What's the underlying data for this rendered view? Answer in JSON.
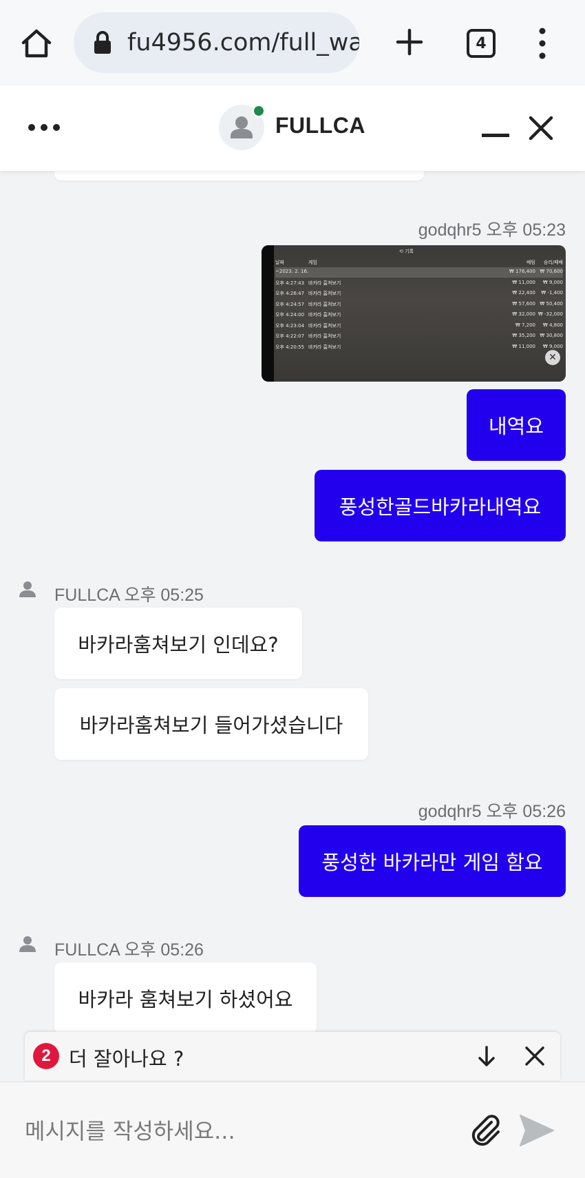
{
  "browser": {
    "url": "fu4956.com/full_wa",
    "tab_count": "4",
    "icons": [
      "home-icon",
      "lock-icon",
      "plus-icon",
      "tabs-icon",
      "kebab-menu-icon"
    ]
  },
  "header": {
    "title": "FULLCA",
    "online": true,
    "online_color": "#1e8a4c"
  },
  "messages": [
    {
      "sender": "godqhr5",
      "time": "오후 05:23",
      "direction": "out",
      "attachment": {
        "type": "image",
        "header": "기록",
        "columns": [
          "날짜",
          "게임",
          "배팅",
          "승리/패배"
        ],
        "rows": [
          {
            "date": "~2023. 2. 16.",
            "game": "",
            "bet": "₩ 176,400",
            "win": "₩ 70,600"
          },
          {
            "date": "오후 4:27:43",
            "game": "바카라 훔쳐보기",
            "bet": "₩ 11,000",
            "win": "₩ 9,000"
          },
          {
            "date": "오후 4:26:47",
            "game": "바카라 훔쳐보기",
            "bet": "₩ 22,400",
            "win": "₩ -1,400"
          },
          {
            "date": "오후 4:24:57",
            "game": "바카라 훔쳐보기",
            "bet": "₩ 57,600",
            "win": "₩ 50,400"
          },
          {
            "date": "오후 4:24:00",
            "game": "바카라 훔쳐보기",
            "bet": "₩ 32,000",
            "win": "₩ -32,000"
          },
          {
            "date": "오후 4:23:04",
            "game": "바카라 훔쳐보기",
            "bet": "₩ 7,200",
            "win": "₩ 4,800"
          },
          {
            "date": "오후 4:22:07",
            "game": "바카라 훔쳐보기",
            "bet": "₩ 35,200",
            "win": "₩ 30,800"
          },
          {
            "date": "오후 4:20:55",
            "game": "바카라 훔쳐보기",
            "bet": "₩ 11,000",
            "win": "₩ 9,000"
          }
        ]
      },
      "texts": [
        "내역요",
        "풍성한골드바카라내역요"
      ]
    },
    {
      "sender": "FULLCA",
      "time": "오후 05:25",
      "direction": "in",
      "texts": [
        "바카라훔쳐보기 인데요?",
        "바카라훔쳐보기 들어가셨습니다"
      ]
    },
    {
      "sender": "godqhr5",
      "time": "오후 05:26",
      "direction": "out",
      "texts": [
        "풍성한 바카라만 게임 함요"
      ]
    },
    {
      "sender": "FULLCA",
      "time": "오후 05:26",
      "direction": "in",
      "texts": [
        "바카라 훔쳐보기 하셨어요"
      ]
    }
  ],
  "notice": {
    "badge": "2",
    "text": "더 잘아나요 ?"
  },
  "composer": {
    "placeholder": "메시지를 작성하세요..."
  },
  "colors": {
    "outgoing_bubble": "#2200ee",
    "incoming_bubble": "#ffffff",
    "background": "#f2f3f5",
    "badge": "#e0173d"
  }
}
